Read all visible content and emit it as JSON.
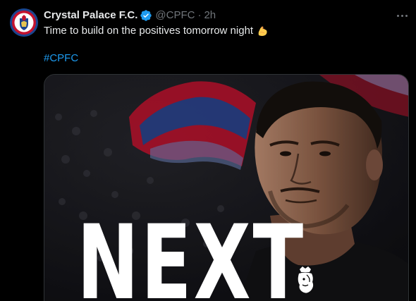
{
  "tweet": {
    "author": {
      "display_name": "Crystal Palace F.C.",
      "handle": "@CPFC",
      "verified_icon": "verified-badge-icon",
      "avatar_icon": "crystal-palace-crest"
    },
    "separator": "·",
    "time": "2h",
    "text": "Time to build on the positives tomorrow night",
    "emoji": "flexed-biceps-emoji",
    "hashtag": "#CPFC",
    "more_icon": "more-options-icon"
  },
  "media": {
    "overlay_text": "NEXT",
    "logo_icon": "premier-league-lion-logo"
  },
  "colors": {
    "background": "#000000",
    "text": "#e7e9ea",
    "secondary": "#71767b",
    "link": "#1d9bf0",
    "verified": "#1d9bf0"
  }
}
